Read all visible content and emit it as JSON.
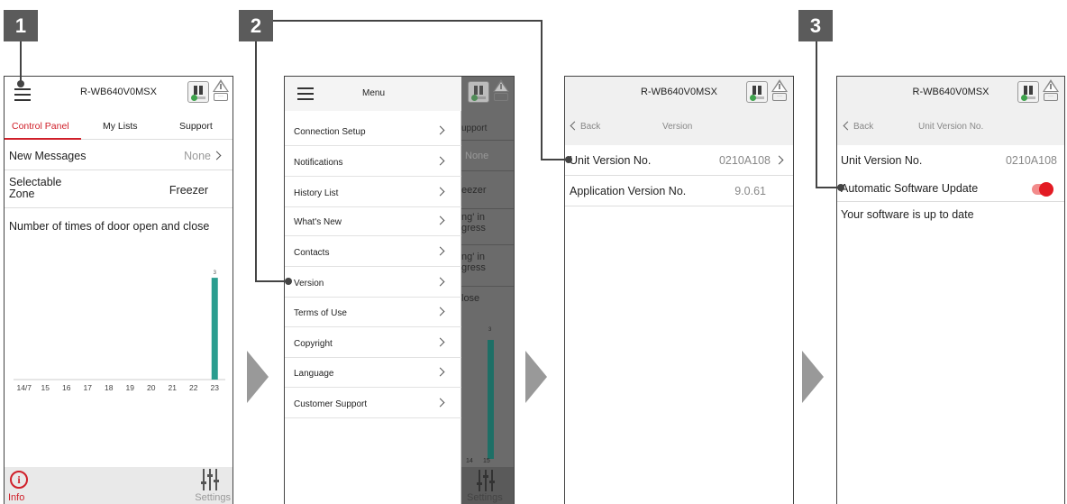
{
  "steps": [
    "1",
    "2",
    "3"
  ],
  "app": {
    "model": "R-WB640V0MSX",
    "fridge_icon": "fridge-status-icon",
    "warning_icon": "warning-icon",
    "warning_box_text": "···"
  },
  "screen1": {
    "tabs": [
      "Control Panel",
      "My Lists",
      "Support"
    ],
    "new_messages_label": "New Messages",
    "new_messages_value": "None",
    "selectable_zone_label": "Selectable\nZone",
    "selectable_zone_value": "Freezer",
    "chart_title": "Number of times of door open and close",
    "footer_info": "Info",
    "footer_settings": "Settings"
  },
  "chart_data": {
    "type": "bar",
    "title": "Number of times of door open and close",
    "categories": [
      "14/7",
      "15",
      "16",
      "17",
      "18",
      "19",
      "20",
      "21",
      "22",
      "23"
    ],
    "values": [
      0,
      0,
      0,
      0,
      0,
      0,
      0,
      0,
      0,
      3
    ],
    "data_labels": [
      "",
      "",
      "",
      "",
      "",
      "",
      "",
      "",
      "",
      "3"
    ],
    "ylim": [
      0,
      3.8
    ],
    "bar_color": "#2a9d8f"
  },
  "screen2": {
    "menu_title": "Menu",
    "items": [
      "Connection Setup",
      "Notifications",
      "History List",
      "What's New",
      "Contacts",
      "Version",
      "Terms of Use",
      "Copyright",
      "Language",
      "Customer Support"
    ],
    "dimmed_texts": [
      "upport",
      "None",
      "eezer",
      "ng' in\ngress",
      "ng' in\ngress",
      "lose",
      "3",
      "14",
      "15",
      "Settings"
    ]
  },
  "screen3": {
    "back": "Back",
    "title": "Version",
    "rows": [
      {
        "label": "Unit Version No.",
        "value": "0210A108"
      },
      {
        "label": "Application Version No.",
        "value": "9.0.61"
      }
    ]
  },
  "screen4": {
    "back": "Back",
    "title": "Unit Version No.",
    "unit_label": "Unit Version No.",
    "unit_value": "0210A108",
    "auto_update_label": "Automatic Software Update",
    "auto_update_on": true,
    "status": "Your software is up to date"
  },
  "colors": {
    "accent_red": "#d0202a",
    "bar_teal": "#2a9d8f",
    "badge_gray": "#5b5b5b",
    "arrow_gray": "#999999"
  }
}
